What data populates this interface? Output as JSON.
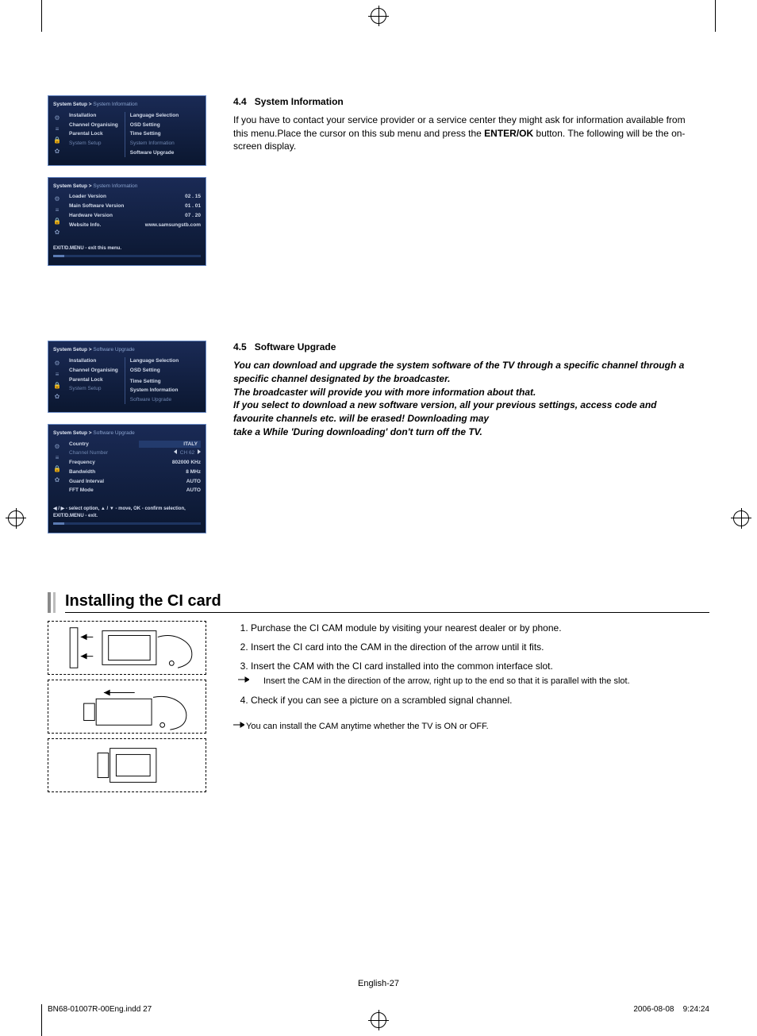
{
  "section44": {
    "num": "4.4",
    "title": "System Information",
    "body": "If you have to contact your service provider or a service center they might ask for information available from this menu.Place the cursor on this sub menu and press the ENTER/OK button. The following will be the on-screen display.",
    "body_pre": "If you have to contact your service provider or a service center they might ask for information available from this menu.Place the cursor on this sub menu and press the ",
    "body_bold": "ENTER/OK",
    "body_post": " button. The following will be the on-screen display."
  },
  "osd1": {
    "crumb_a": "System Setup > ",
    "crumb_b": "System Information",
    "left": [
      "Installation",
      "Channel Organising",
      "Parental Lock",
      "System Setup"
    ],
    "right": [
      "Language Selection",
      "OSD Setting",
      "Time Setting",
      "System Information",
      "Software Upgrade"
    ],
    "right_active_index": 3
  },
  "osd2": {
    "crumb_a": "System Setup > ",
    "crumb_b": "System Information",
    "rows": [
      {
        "k": "Loader Version",
        "v": "02 . 15"
      },
      {
        "k": "Main Software Version",
        "v": "01 . 01"
      },
      {
        "k": "Hardware Version",
        "v": "07 . 20"
      },
      {
        "k": "Website Info.",
        "v": "www.samsungstb.com"
      }
    ],
    "hint": "EXIT/D.MENU - exit this menu."
  },
  "section45": {
    "num": "4.5",
    "title": "Software Upgrade",
    "body1": "You can download and upgrade the system software of the TV through a specific channel through a specific channel designated by the broadcaster.",
    "body2": "The broadcaster will provide you with more information about that.",
    "body3": "If you select to download a new software version, all your previous settings, access code and favourite channels etc. will be erased! Downloading may",
    "body4": "take a While 'During downloading' don't turn off the TV."
  },
  "osd3": {
    "crumb_a": "System Setup > ",
    "crumb_b": "Software Upgrade",
    "left": [
      "Installation",
      "Channel Organising",
      "Parental Lock",
      "System Setup"
    ],
    "right": [
      "Language Selection",
      "OSD Setting",
      "Time Setting",
      "System Information",
      "Software Upgrade"
    ],
    "right_active_index": 4
  },
  "osd4": {
    "crumb_a": "System Setup > ",
    "crumb_b": "Software Upgrade",
    "rows": [
      {
        "k": "Country",
        "v": "ITALY",
        "active": true
      },
      {
        "k": "Channel Number",
        "v": "CH   62",
        "arrows": true
      },
      {
        "k": "Frequency",
        "v": "802000 KHz"
      },
      {
        "k": "Bandwidth",
        "v": "8 MHz"
      },
      {
        "k": "Guard Interval",
        "v": "AUTO"
      },
      {
        "k": "FFT Mode",
        "v": "AUTO"
      }
    ],
    "hint1": "◀ / ▶ - select option, ▲ / ▼ - move, OK - confirm selection,",
    "hint2": "EXIT/D.MENU - exit."
  },
  "ci": {
    "title": "Installing the CI card",
    "steps": [
      "Purchase the CI CAM module by visiting your nearest dealer or by phone.",
      "Insert the CI card into the CAM in the direction of the arrow until it fits.",
      "Insert the CAM with the CI card installed into the common interface slot.",
      "Check if you can see a picture on a scrambled signal channel."
    ],
    "subnote": "Insert the CAM in the direction of the arrow, right up to the end so that it is parallel with the slot.",
    "final": "You can install the CAM anytime whether the TV is ON or OFF."
  },
  "footer": "English-27",
  "print": {
    "left": "BN68-01007R-00Eng.indd   27",
    "mid": "",
    "right_date": "2006-08-08",
    "right_time": "9:24:24"
  }
}
